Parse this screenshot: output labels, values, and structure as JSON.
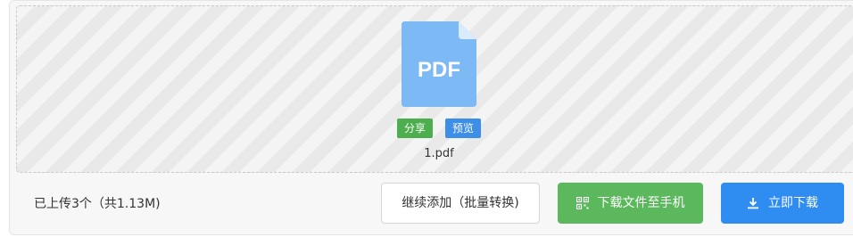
{
  "file": {
    "icon_label": "PDF",
    "name": "1.pdf",
    "share_label": "分享",
    "preview_label": "预览"
  },
  "footer": {
    "status": "已上传3个（共1.13M)",
    "continue_label": "继续添加（批量转换)",
    "phone_label": "下载文件至手机",
    "download_label": "立即下载"
  },
  "icons": {
    "file": "pdf-file-icon",
    "qr": "qr-code-icon",
    "download": "download-icon"
  },
  "colors": {
    "file_icon": "#7db9f5",
    "share": "#4cae4c",
    "preview": "#3c8ee6",
    "phone_button": "#5cb85c",
    "download_button": "#2f8cf0"
  }
}
